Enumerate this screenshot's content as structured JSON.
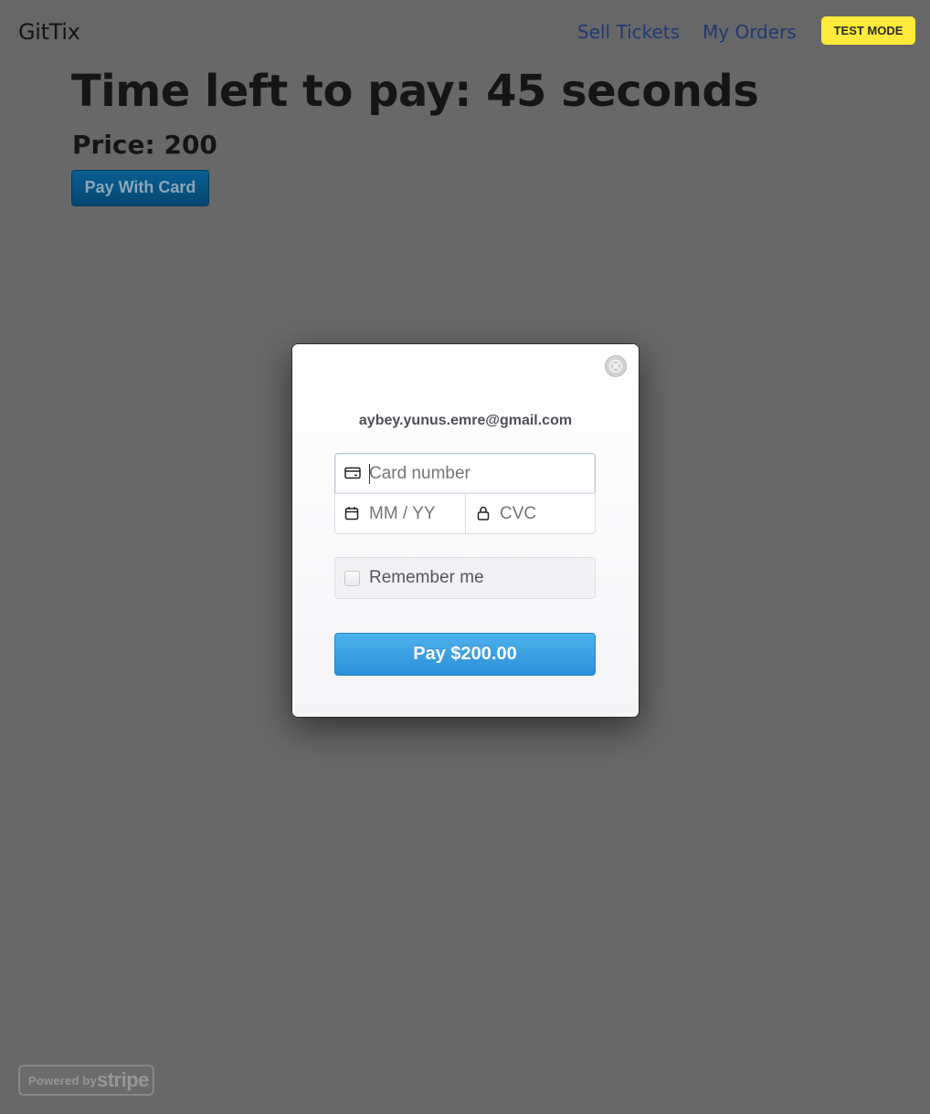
{
  "navbar": {
    "brand": "GitTix",
    "links": [
      {
        "label": "Sell Tickets"
      },
      {
        "label": "My Orders"
      }
    ],
    "test_mode_badge": "TEST MODE"
  },
  "main": {
    "headline": "Time left to pay: 45 seconds",
    "price": "Price: 200",
    "pay_with_card_label": "Pay With Card"
  },
  "checkout_modal": {
    "email": "aybey.yunus.emre@gmail.com",
    "card_number_placeholder": "Card number",
    "expiry_placeholder": "MM / YY",
    "cvc_placeholder": "CVC",
    "remember_me_label": "Remember me",
    "remember_me_checked": false,
    "pay_button_label": "Pay $200.00",
    "close_icon": "close-icon",
    "card_icon": "credit-card-icon",
    "calendar_icon": "calendar-icon",
    "lock_icon": "lock-icon",
    "accent_color": "#3a9fe3"
  },
  "footer": {
    "powered_by": "Powered by",
    "stripe": "stripe"
  },
  "colors": {
    "overlay": "#686868",
    "test_mode_bg": "#fdea3a",
    "nav_link": "#1f3a70"
  }
}
